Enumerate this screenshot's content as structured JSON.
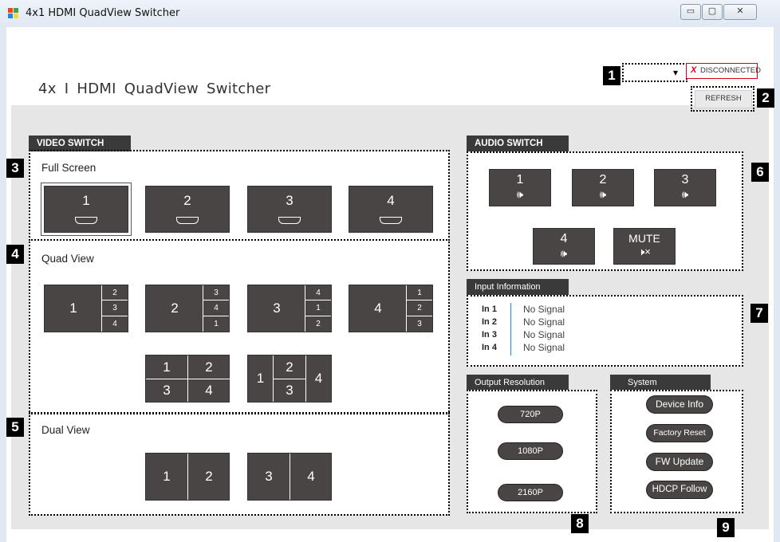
{
  "window": {
    "title": "4x1 HDMI QuadView Switcher",
    "min_glyph": "▭",
    "max_glyph": "▢",
    "close_glyph": "✕"
  },
  "header": {
    "app_title": "4x I   HDMI   QuadView   Switcher",
    "port_select_value": "",
    "dropdown_arrow": "▾",
    "status_x": "X",
    "status_text": "DISCONNECTED",
    "refresh_label": "REFRESH"
  },
  "callouts": [
    "1",
    "2",
    "3",
    "4",
    "5",
    "6",
    "7",
    "8",
    "9"
  ],
  "video_switch": {
    "header": "VIDEO SWITCH",
    "full_screen": {
      "label": "Full Screen",
      "tiles": [
        "1",
        "2",
        "3",
        "4"
      ]
    },
    "quad_view": {
      "label": "Quad View",
      "tiles": [
        {
          "main": "1",
          "side": [
            "2",
            "3",
            "4"
          ]
        },
        {
          "main": "2",
          "side": [
            "3",
            "4",
            "1"
          ]
        },
        {
          "main": "3",
          "side": [
            "4",
            "1",
            "2"
          ]
        },
        {
          "main": "4",
          "side": [
            "1",
            "2",
            "3"
          ]
        }
      ],
      "grid_tile": [
        "1",
        "2",
        "3",
        "4"
      ],
      "pip_tile": {
        "left": "1",
        "top": "2",
        "bottom": "3",
        "right": "4"
      }
    },
    "dual_view": {
      "label": "Dual View",
      "tiles": [
        [
          "1",
          "2"
        ],
        [
          "3",
          "4"
        ]
      ]
    }
  },
  "audio_switch": {
    "header": "AUDIO SWITCH",
    "buttons": [
      "1",
      "2",
      "3",
      "4"
    ],
    "speaker_glyph": "🕪",
    "mute_label": "MUTE",
    "mute_glyph": "🕨×"
  },
  "input_information": {
    "header": "Input Information",
    "rows": [
      {
        "label": "In 1",
        "value": "No Signal"
      },
      {
        "label": "In 2",
        "value": "No Signal"
      },
      {
        "label": "In 3",
        "value": "No Signal"
      },
      {
        "label": "In 4",
        "value": "No Signal"
      }
    ]
  },
  "output_resolution": {
    "header": "Output Resolution",
    "options": [
      "720P",
      "1080P",
      "2160P"
    ]
  },
  "system": {
    "header": "System",
    "buttons": [
      "Device Info",
      "Factory Reset",
      "FW Update",
      "HDCP Follow"
    ]
  },
  "colors": {
    "tile_bg": "#4a4545",
    "section_header_bg": "#3a3a3a",
    "status_red": "#d0021b",
    "content_bg": "#e6e6e6"
  }
}
